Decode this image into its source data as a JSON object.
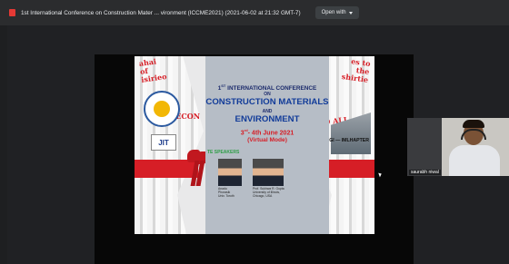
{
  "window": {
    "title": "1st International Conference on Construction Mater ... vironment (ICCME2021) (2021-06-02 at 21:32 GMT-7)",
    "open_with_label": "Open with",
    "file_icon": "red-file-icon",
    "dropdown_icon": "chevron-down-icon"
  },
  "slide": {
    "line1_prefix": "1",
    "line1_sup": "ST",
    "line1_rest": " INTERNATIONAL CONFERENCE",
    "line2": "ON",
    "line3": "CONSTRUCTION MATERIALS",
    "line4": "AND",
    "line5": "ENVIRONMENT",
    "date_prefix": "3",
    "date_sup": "rd",
    "date_rest": "- 4th June 2021",
    "mode": "(Virtual Mode)",
    "speakers_label": "TE SPEAKERS",
    "speaker1_caption": "Anadu\nPhorasik\nUniv. Toroth",
    "speaker2_caption": "Prof. Sukhwa R. Gupta\nUniversity of Illinois,\nChicago, USA",
    "left_red_top": "ahai\nof\nisirieo",
    "left_red_mid": "NECON",
    "right_red_top": "es to\nthe\nshirtie",
    "right_red_mid": "ES YO ALL",
    "logo_text": "JIT",
    "building_caption": "IGI — IMLHAPTER"
  },
  "self_view": {
    "name": "saurabh niwal"
  },
  "colors": {
    "title_bar_bg": "#2b2c2e",
    "viewer_bg": "#202124",
    "accent_red": "#d61e26",
    "accent_blue": "#123c99"
  }
}
